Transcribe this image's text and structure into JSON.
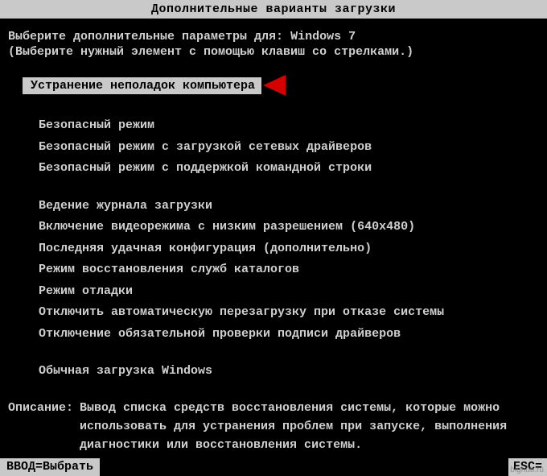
{
  "title": "Дополнительные варианты загрузки",
  "prompt": {
    "prefix": "Выберите дополнительные параметры для:",
    "os": "Windows 7"
  },
  "hint": "(Выберите нужный элемент с помощью клавиш со стрелками.)",
  "selected": "Устранение неполадок компьютера",
  "group1": [
    "Безопасный режим",
    "Безопасный режим с загрузкой сетевых драйверов",
    "Безопасный режим с поддержкой командной строки"
  ],
  "group2": [
    "Ведение журнала загрузки",
    "Включение видеорежима с низким разрешением (640x480)",
    "Последняя удачная конфигурация (дополнительно)",
    "Режим восстановления служб каталогов",
    "Режим отладки",
    "Отключить автоматическую перезагрузку при отказе системы",
    "Отключение обязательной проверки подписи драйверов"
  ],
  "group3": [
    "Обычная загрузка Windows"
  ],
  "description": {
    "label": "Описание:",
    "text": "Вывод списка средств восстановления системы, которые можно использовать для устранения проблем при запуске, выполнения диагностики или восстановления системы."
  },
  "footer": {
    "enter": "ВВОД=Выбрать",
    "esc": "ESC="
  },
  "watermark": "bighub.ru"
}
